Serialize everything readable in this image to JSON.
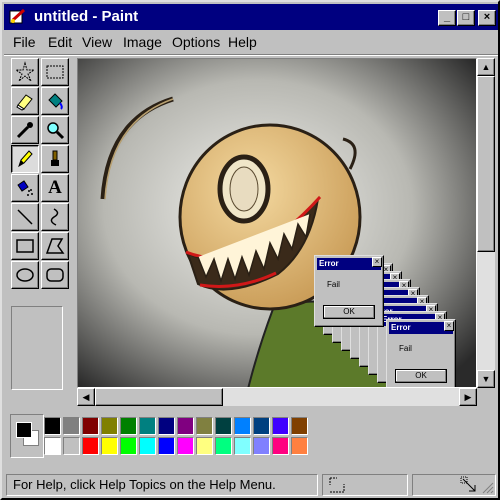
{
  "window": {
    "title": "untitled - Paint",
    "minimize_glyph": "_",
    "maximize_glyph": "□",
    "close_glyph": "×"
  },
  "menu": [
    "File",
    "Edit",
    "View",
    "Image",
    "Options",
    "Help"
  ],
  "tools": [
    {
      "name": "free-form-select-tool",
      "icon": "star-select-icon"
    },
    {
      "name": "select-tool",
      "icon": "rect-select-icon"
    },
    {
      "name": "eraser-tool",
      "icon": "eraser-icon"
    },
    {
      "name": "fill-tool",
      "icon": "paint-bucket-icon"
    },
    {
      "name": "pick-color-tool",
      "icon": "eyedropper-icon"
    },
    {
      "name": "magnifier-tool",
      "icon": "magnifier-icon"
    },
    {
      "name": "pencil-tool",
      "icon": "pencil-icon",
      "selected": true
    },
    {
      "name": "brush-tool",
      "icon": "brush-icon"
    },
    {
      "name": "airbrush-tool",
      "icon": "airbrush-icon"
    },
    {
      "name": "text-tool",
      "icon": "text-icon",
      "label": "A"
    },
    {
      "name": "line-tool",
      "icon": "line-icon"
    },
    {
      "name": "curve-tool",
      "icon": "curve-icon"
    },
    {
      "name": "rectangle-tool",
      "icon": "rectangle-icon"
    },
    {
      "name": "polygon-tool",
      "icon": "polygon-icon"
    },
    {
      "name": "ellipse-tool",
      "icon": "ellipse-icon"
    },
    {
      "name": "rounded-rectangle-tool",
      "icon": "rounded-rect-icon"
    }
  ],
  "colors": {
    "foreground": "#000000",
    "background": "#ffffff",
    "row1": [
      "#000000",
      "#808080",
      "#800000",
      "#808000",
      "#008000",
      "#008080",
      "#000080",
      "#800080",
      "#808040",
      "#004040",
      "#0080ff",
      "#004080",
      "#4000ff",
      "#804000"
    ],
    "row2": [
      "#ffffff",
      "#c0c0c0",
      "#ff0000",
      "#ffff00",
      "#00ff00",
      "#00ffff",
      "#0000ff",
      "#ff00ff",
      "#ffff80",
      "#00ff80",
      "#80ffff",
      "#8080ff",
      "#ff0080",
      "#ff8040"
    ]
  },
  "error_dialog": {
    "title": "Error",
    "message": "Fail",
    "ok_label": "OK"
  },
  "status": {
    "message": "For Help, click Help Topics on the Help Menu."
  }
}
